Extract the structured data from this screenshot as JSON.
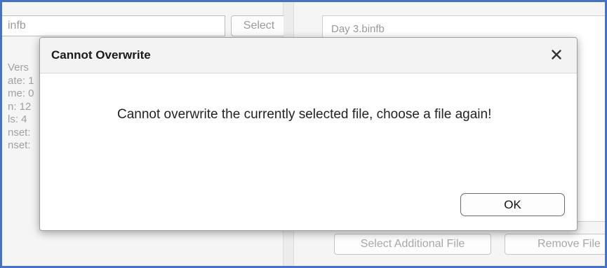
{
  "left_panel": {
    "file_field_value": "infb",
    "select_label": "Select",
    "info_lines": [
      "Vers",
      "ate: 1",
      "me: 0",
      "n: 12",
      "ls: 4",
      "nset:",
      "nset:"
    ]
  },
  "right_panel": {
    "file_name": "Day 3.binfb",
    "add_file_label": "Select Additional File",
    "remove_file_label": "Remove File"
  },
  "dialog": {
    "title": "Cannot Overwrite",
    "close_icon": "close-icon",
    "message": "Cannot overwrite the currently selected file, choose a file again!",
    "ok_label": "OK"
  },
  "colors": {
    "frame_border": "#4472c4",
    "dialog_header": "#f3f3f3",
    "disabled_text": "#9a9a9a"
  }
}
